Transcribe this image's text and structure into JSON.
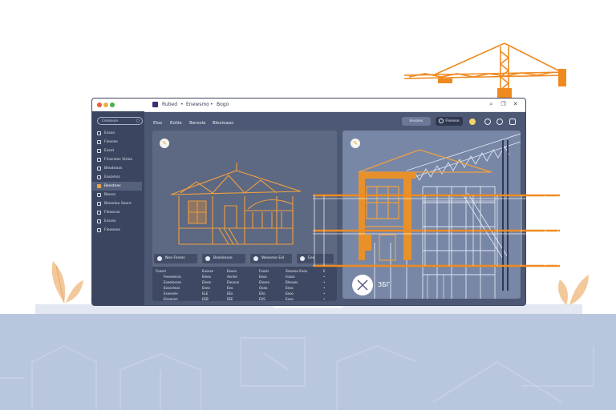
{
  "colors": {
    "accent": "#e8912a",
    "panel": "#5d6882",
    "sidebar": "#3b4560",
    "floor": "#b9c7de"
  },
  "titlebar": {
    "breadcrumb": [
      "Rubed",
      "Enewsmo",
      "Bogo"
    ],
    "separator": "•",
    "icons": [
      "search-icon",
      "copy-icon",
      "close-icon"
    ]
  },
  "sidebar": {
    "search_placeholder": "Cresseure",
    "items": [
      {
        "label": "Essoo",
        "icon": "home-icon"
      },
      {
        "label": "Flesoes",
        "icon": "folder-icon"
      },
      {
        "label": "Eosel",
        "icon": "file-icon"
      },
      {
        "label": "Flnsciees Vislas",
        "icon": "layers-icon"
      },
      {
        "label": "Bleatnoos",
        "icon": "grid-icon"
      },
      {
        "label": "Easomss",
        "icon": "box-icon"
      },
      {
        "label": "Beestees",
        "icon": "folder-icon",
        "active": true
      },
      {
        "label": "Blesss",
        "icon": "chart-icon"
      },
      {
        "label": "Blooeloo Soore",
        "icon": "building-icon"
      },
      {
        "label": "Fleoocse",
        "icon": "layers-icon"
      },
      {
        "label": "Essres",
        "icon": "list-icon"
      },
      {
        "label": "Fleoooes",
        "icon": "settings-icon"
      }
    ]
  },
  "topbar": {
    "menu": [
      "Elos",
      "Eoliie",
      "Bersole",
      "Blesloaos"
    ],
    "primary_button": "Eesoles",
    "secondary_button": "Fleoose",
    "icons": [
      "sun-icon",
      "status-icon",
      "clock-icon",
      "edit-icon"
    ]
  },
  "left_panel": {
    "tabs": [
      "Nee Feress",
      "Beslolesse",
      "Weesese Eel",
      "Ees"
    ],
    "table_rows": [
      [
        "Foosel",
        "Euosse",
        "Eeoso",
        "Foosls",
        "Sleoeoe Eeoo",
        "Eeo",
        "E"
      ],
      [
        "Feeseleces",
        "Eleeo",
        "Aerlee",
        "Eeoo",
        "Fooso",
        "Esolo",
        "•"
      ],
      [
        "Eoeelesses",
        "Eleeo",
        "Elessoe",
        "Eleeso",
        "Bleoses",
        "Eleese",
        "•"
      ],
      [
        "Eosseleoo",
        "Eeeo",
        "Eeo",
        "Ooeo",
        "Eeso",
        "Fleeso",
        "•"
      ],
      [
        "Eseesele",
        "ELE",
        "EEo",
        "E0o",
        "Eeoo",
        "Boosn",
        "•"
      ],
      [
        "Elsseeee",
        "EEB",
        "EEE",
        "E0S",
        "Eeoo",
        "Eeeeo",
        "•"
      ]
    ]
  },
  "right_panel": {
    "close_label": "ЗБГ"
  }
}
